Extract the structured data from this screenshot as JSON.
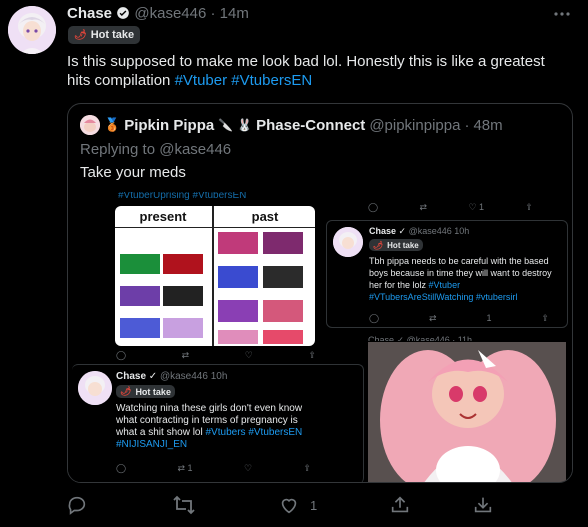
{
  "tweet": {
    "display_name": "Chase",
    "handle": "@kase446",
    "sep": "·",
    "time": "14m",
    "badge": "Hot take",
    "text_plain": "Is this supposed to make me look bad lol. Honestly this is like a greatest hits compilation",
    "hashtag1": "#Vtuber",
    "hashtag2": "#VtubersEN",
    "actions": {
      "likes": "1"
    }
  },
  "quote": {
    "display_name": "Pipkin Pippa",
    "org": "Phase-Connect",
    "handle": "@pipkinpippa",
    "sep": "·",
    "time": "48m",
    "replying_to": "Replying to @kase446",
    "text": "Take your meds"
  },
  "collage": {
    "cropped_hashtags": "#VtuberUprising #VtubersEN",
    "present_label": "present",
    "past_label": "past",
    "pills": "1",
    "mini1": {
      "name": "Chase",
      "handle": "@kase446",
      "time": "10h",
      "badge": "Hot take",
      "text": "Tbh pippa needs to be careful with the based boys because in time they will want to destroy her for the lolz",
      "tag1": "#Vtuber",
      "tag2": "#VTubersAreStillWatching",
      "tag3": "#vtubersirl",
      "like_count": "1"
    },
    "mini2": {
      "name": "Chase",
      "handle": "@kase446",
      "time": "10h",
      "badge": "Hot take",
      "text": "Watching nina these girls don't even know what contracting in terms of pregnancy is what a shit show lol",
      "tag1": "#Vtubers",
      "tag2": "#VtubersEN",
      "tag3": "#NIJISANJI_EN",
      "like_count": "1"
    },
    "cropped_top_handle": "@kase446 · 10h",
    "cropped_bottom": "Chase ✓ @kase446 · 10h",
    "cropped_right": "Chase ✓ @kase446 · 11h"
  },
  "colors": {
    "background": "#000000",
    "link": "#1d9bf0",
    "muted": "#71767b",
    "border": "#333639"
  }
}
